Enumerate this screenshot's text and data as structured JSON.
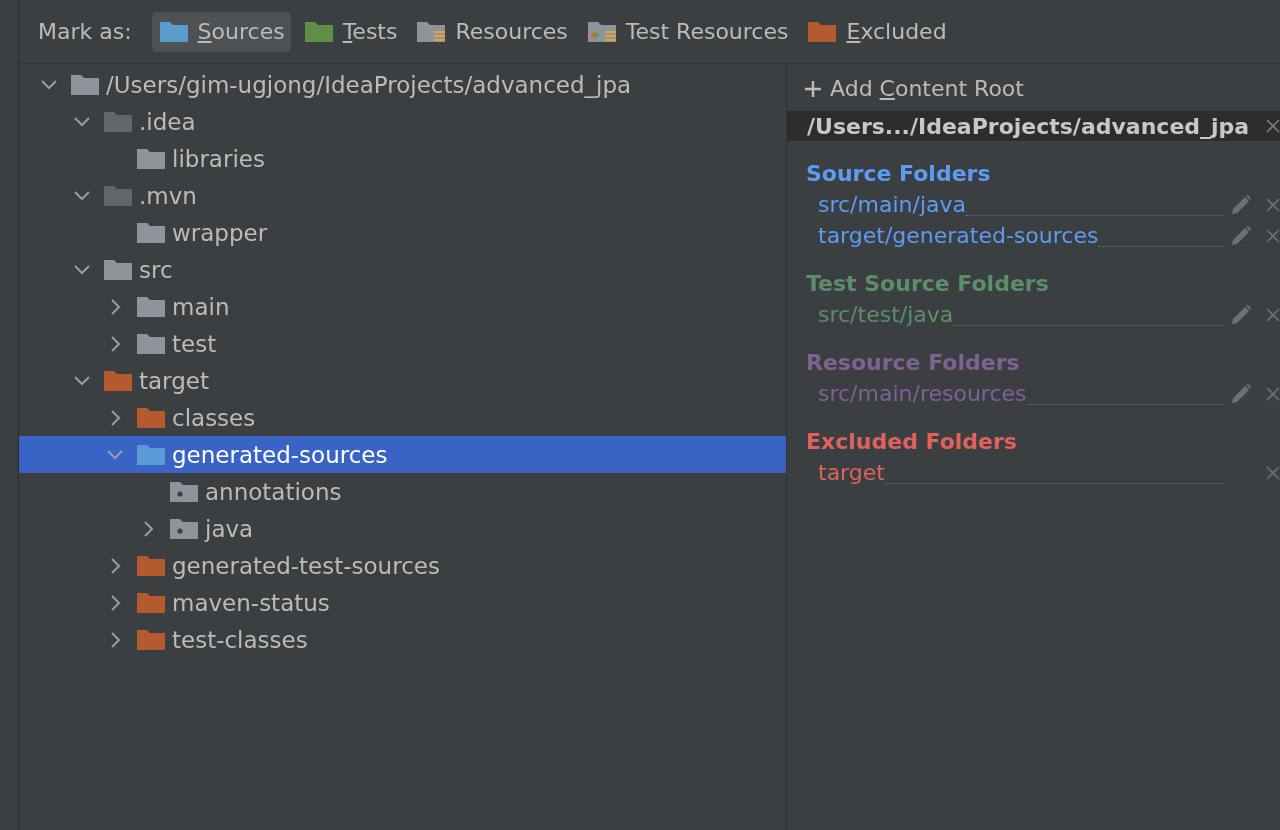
{
  "toolbar": {
    "label": "Mark as:",
    "buttons": [
      {
        "kind": "sources",
        "key": "S",
        "after": "ources",
        "selected": true
      },
      {
        "kind": "tests",
        "key": "T",
        "after": "ests",
        "selected": false
      },
      {
        "kind": "resources",
        "before": "Resources",
        "selected": false
      },
      {
        "kind": "test-resources",
        "before": "Test Resources",
        "selected": false
      },
      {
        "kind": "excluded",
        "key": "E",
        "after": "xcluded",
        "selected": false
      }
    ]
  },
  "tree": [
    {
      "label": "/Users/gim-ugjong/IdeaProjects/advanced_jpa",
      "kind": "plain",
      "expanded": true,
      "selected": false,
      "children": [
        {
          "label": ".idea",
          "kind": "dim",
          "expanded": true,
          "selected": false,
          "children": [
            {
              "label": "libraries",
              "kind": "plain",
              "selected": false
            }
          ]
        },
        {
          "label": ".mvn",
          "kind": "dim",
          "expanded": true,
          "selected": false,
          "children": [
            {
              "label": "wrapper",
              "kind": "plain",
              "selected": false
            }
          ]
        },
        {
          "label": "src",
          "kind": "plain",
          "expanded": true,
          "selected": false,
          "children": [
            {
              "label": "main",
              "kind": "plain",
              "expanded": false,
              "selected": false
            },
            {
              "label": "test",
              "kind": "plain",
              "expanded": false,
              "selected": false
            }
          ]
        },
        {
          "label": "target",
          "kind": "excluded",
          "expanded": true,
          "selected": false,
          "children": [
            {
              "label": "classes",
              "kind": "excluded",
              "expanded": false,
              "selected": false
            },
            {
              "label": "generated-sources",
              "kind": "source",
              "expanded": true,
              "selected": true,
              "children": [
                {
                  "label": "annotations",
                  "kind": "generated",
                  "selected": false
                },
                {
                  "label": "java",
                  "kind": "generated",
                  "expanded": false,
                  "selected": false
                }
              ]
            },
            {
              "label": "generated-test-sources",
              "kind": "excluded",
              "expanded": false,
              "selected": false
            },
            {
              "label": "maven-status",
              "kind": "excluded",
              "expanded": false,
              "selected": false
            },
            {
              "label": "test-classes",
              "kind": "excluded",
              "expanded": false,
              "selected": false
            }
          ]
        }
      ]
    }
  ],
  "content_root": {
    "add_button": {
      "before": "Add ",
      "key": "C",
      "after": "ontent Root"
    },
    "path": "/Users.../IdeaProjects/advanced_jpa",
    "groups": [
      {
        "title": "Source Folders",
        "color": "#5c9cf2",
        "entries": [
          {
            "path": "src/main/java",
            "editable": true
          },
          {
            "path": "target/generated-sources",
            "editable": true
          }
        ]
      },
      {
        "title": "Test Source Folders",
        "color": "#5b8f68",
        "entries": [
          {
            "path": "src/test/java",
            "editable": true
          }
        ]
      },
      {
        "title": "Resource Folders",
        "color": "#7d6294",
        "entries": [
          {
            "path": "src/main/resources",
            "editable": true
          }
        ]
      },
      {
        "title": "Excluded Folders",
        "color": "#e0615d",
        "entries": [
          {
            "path": "target",
            "editable": false
          }
        ]
      }
    ]
  }
}
